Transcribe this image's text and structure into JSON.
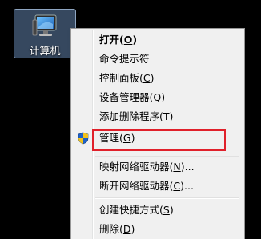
{
  "desktop": {
    "icon": {
      "label": "计算机",
      "icon_name": "computer-icon"
    }
  },
  "context_menu": {
    "items": [
      {
        "id": "open",
        "text": "打开(",
        "key": "O",
        "suffix": ")",
        "bold": true
      },
      {
        "id": "cmd",
        "text": "命令提示符",
        "key": "",
        "suffix": "",
        "bold": false
      },
      {
        "id": "control-panel",
        "text": "控制面板(",
        "key": "C",
        "suffix": ")",
        "bold": false
      },
      {
        "id": "device-manager",
        "text": "设备管理器(",
        "key": "Q",
        "suffix": ")",
        "bold": false
      },
      {
        "id": "add-remove",
        "text": "添加删除程序(",
        "key": "T",
        "suffix": ")",
        "bold": false
      },
      {
        "id": "manage",
        "text": "管理(",
        "key": "G",
        "suffix": ")",
        "bold": false,
        "icon": "uac-shield-icon"
      },
      {
        "id": "map-drive",
        "text": "映射网络驱动器(",
        "key": "N",
        "suffix": ")...",
        "bold": false
      },
      {
        "id": "disconnect-drive",
        "text": "断开网络驱动器(",
        "key": "C",
        "suffix": ")...",
        "bold": false
      },
      {
        "id": "create-shortcut",
        "text": "创建快捷方式(",
        "key": "S",
        "suffix": ")",
        "bold": false
      },
      {
        "id": "delete",
        "text": "删除(",
        "key": "D",
        "suffix": ")",
        "bold": false
      }
    ]
  },
  "colors": {
    "highlight_border": "#e0202a",
    "menu_background": "#f0f0f0"
  }
}
